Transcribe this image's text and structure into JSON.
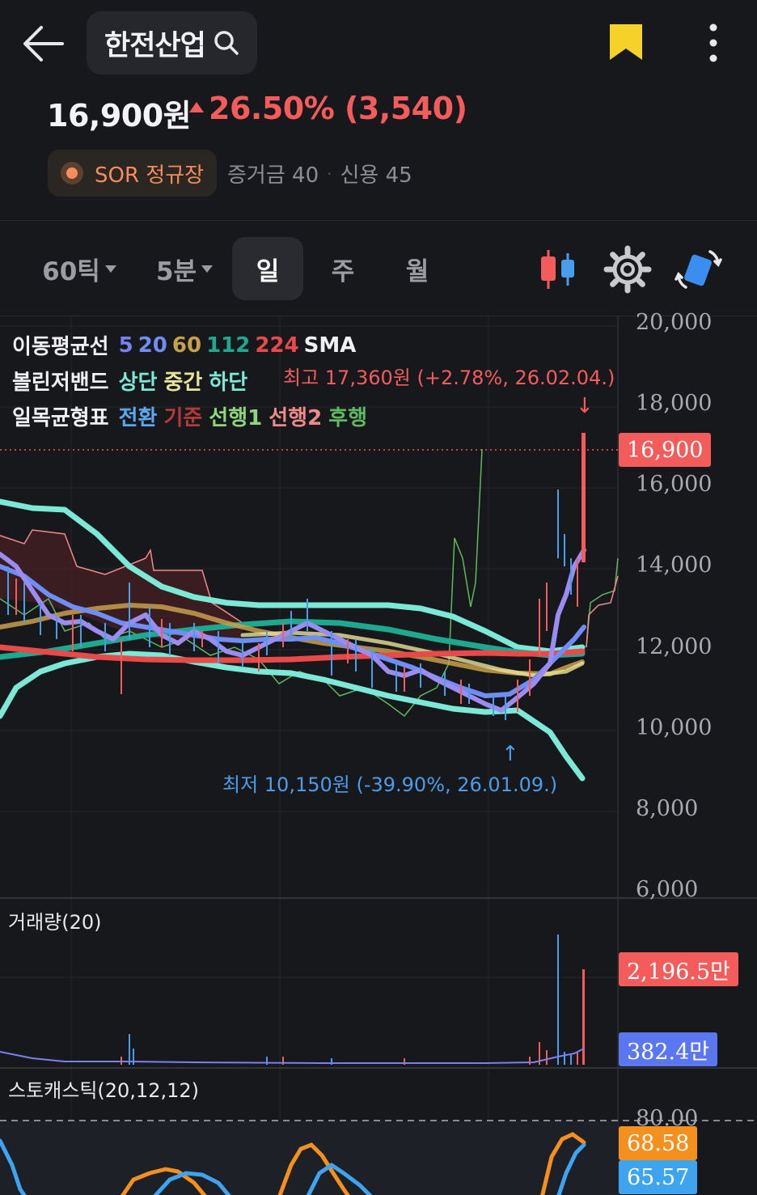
{
  "header": {
    "title": "한전산업",
    "price": "16,900원",
    "change": "26.50% (3,540)",
    "market_label": "SOR 정규장",
    "margin_label": "증거금 40",
    "credit_label": "신용 45"
  },
  "toolbar": {
    "timeframes": [
      "60틱",
      "5분",
      "일",
      "주",
      "월"
    ],
    "active": "일"
  },
  "legend": {
    "ma_label": "이동평균선",
    "ma_periods": [
      "5",
      "20",
      "60",
      "112",
      "224"
    ],
    "ma_type": "SMA",
    "bb_label": "볼린저밴드",
    "bb_items": [
      "상단",
      "중간",
      "하단"
    ],
    "ichimoku_label": "일목균형표",
    "ichimoku_items": [
      "전환",
      "기준",
      "선행1",
      "선행2",
      "후행"
    ]
  },
  "annotations": {
    "high": "최고 17,360원 (+2.78%, 26.02.04.)",
    "low": "최저 10,150원 (-39.90%, 26.01.09.)"
  },
  "price_axis": [
    "20,000",
    "18,000",
    "16,000",
    "14,000",
    "12,000",
    "10,000",
    "8,000",
    "6,000"
  ],
  "current_price_tag": "16,900",
  "volume": {
    "title": "거래량(20)",
    "current_tag": "2,196.5만",
    "ma_tag": "382.4만"
  },
  "stochastic": {
    "title": "스토캐스틱(20,12,12)",
    "axis_top": "80.00",
    "k_tag": "68.58",
    "d_tag": "65.57"
  },
  "colors": {
    "up": "#f45b5b",
    "down": "#4a9de8",
    "ma5": "#7b80f0",
    "ma20": "#6f8df5",
    "ma60": "#c8a04a",
    "ma112": "#1ea890",
    "ma224": "#e84a4a",
    "bollinger": "#7ce8d6",
    "ichimoku_conv": "#5aa8f0",
    "ichimoku_base": "#b23a3a",
    "ichimoku_lead1": "#8fd67a",
    "ichimoku_lead2": "#f08a8a",
    "ichimoku_lag": "#5fb85f",
    "accent_yellow": "#f5d22a"
  }
}
